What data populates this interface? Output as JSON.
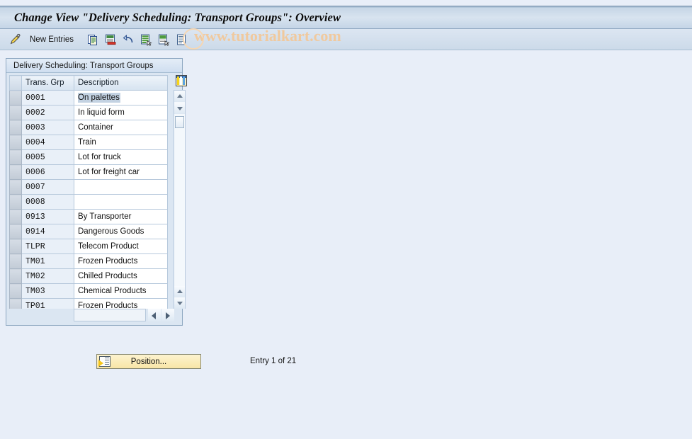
{
  "window": {
    "title": "Change View \"Delivery Scheduling: Transport Groups\": Overview"
  },
  "toolbar": {
    "new_entries_label": "New Entries",
    "icons": [
      {
        "name": "pencil-display-change-icon"
      },
      {
        "name": "copy-icon"
      },
      {
        "name": "delete-icon"
      },
      {
        "name": "undo-icon"
      },
      {
        "name": "details-icon"
      },
      {
        "name": "variant-icon"
      },
      {
        "name": "print-icon"
      }
    ]
  },
  "watermark": {
    "text": "www.tutorialkart.com"
  },
  "panel": {
    "title": "Delivery Scheduling: Transport Groups",
    "columns": {
      "select": "",
      "code": "Trans. Grp",
      "description": "Description"
    },
    "column_config_icon": "column-config-icon",
    "rows": [
      {
        "code": "0001",
        "description": "On palettes",
        "selected": true
      },
      {
        "code": "0002",
        "description": "In liquid form",
        "selected": false
      },
      {
        "code": "0003",
        "description": "Container",
        "selected": false
      },
      {
        "code": "0004",
        "description": "Train",
        "selected": false
      },
      {
        "code": "0005",
        "description": "Lot for truck",
        "selected": false
      },
      {
        "code": "0006",
        "description": "Lot for freight car",
        "selected": false
      },
      {
        "code": "0007",
        "description": "",
        "selected": false
      },
      {
        "code": "0008",
        "description": "",
        "selected": false
      },
      {
        "code": "0913",
        "description": "By Transporter",
        "selected": false
      },
      {
        "code": "0914",
        "description": "Dangerous Goods",
        "selected": false
      },
      {
        "code": "TLPR",
        "description": "Telecom Product",
        "selected": false
      },
      {
        "code": "TM01",
        "description": "Frozen Products",
        "selected": false
      },
      {
        "code": "TM02",
        "description": "Chilled Products",
        "selected": false
      },
      {
        "code": "TM03",
        "description": "Chemical Products",
        "selected": false
      },
      {
        "code": "TP01",
        "description": "Frozen Products",
        "selected": false
      }
    ],
    "horizontal_field_value": ""
  },
  "footer": {
    "position_button_label": "Position...",
    "entry_status": "Entry 1 of 21"
  },
  "colors": {
    "background": "#e8eef8",
    "title_bar": "#c6d6e6",
    "accent_button": "#f8e5a6",
    "selection": "#c3d2e2",
    "watermark": "#f2c89a"
  }
}
